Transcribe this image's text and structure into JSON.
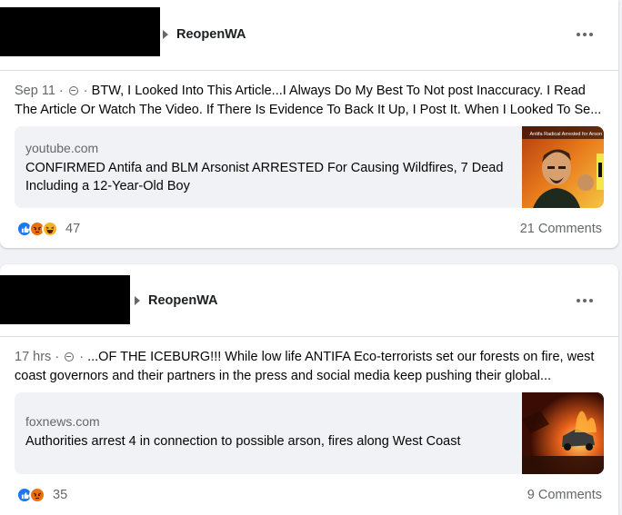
{
  "posts": [
    {
      "group_name": "ReopenWA",
      "timestamp": "Sep 11",
      "text": "BTW, I Looked Into This Article...I Always Do My Best To Not post Inaccuracy. I Read The Article Or Watch The Video. If There Is Evidence To Back It Up, I Post It. When I Looked To Se...",
      "link": {
        "domain": "youtube.com",
        "headline": "CONFIRMED Antifa and BLM Arsonist ARRESTED For Causing Wildfires, 7 Dead Including a 12-Year-Old Boy",
        "thumb_caption": "Antifa Radical Arrested for Arson"
      },
      "reactions": [
        "like-icon",
        "angry-icon",
        "haha-icon"
      ],
      "reaction_count": "47",
      "comments": "21 Comments"
    },
    {
      "group_name": "ReopenWA",
      "timestamp": "17 hrs",
      "text": "...OF THE ICEBURG!!! While low life ANTIFA Eco-terrorists set our forests on fire, west coast governors and their partners in the press and social media keep pushing their global...",
      "link": {
        "domain": "foxnews.com",
        "headline": "Authorities arrest 4 in connection to possible arson, fires along West Coast"
      },
      "reactions": [
        "like-icon",
        "angry-icon"
      ],
      "reaction_count": "35",
      "comments": "9 Comments"
    }
  ],
  "colors": {
    "background": "#f0f2f5",
    "card": "#ffffff",
    "secondary_text": "#65676b",
    "like": "#1877f2",
    "angry": "#e9710f",
    "haha": "#f7b125"
  }
}
